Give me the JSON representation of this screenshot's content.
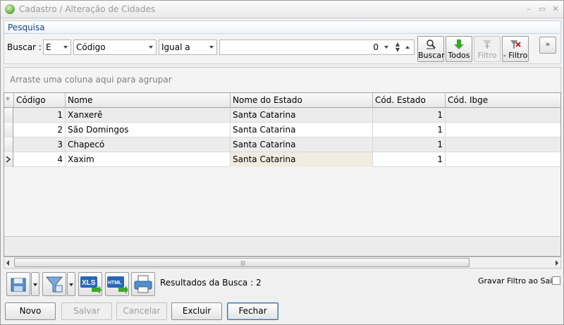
{
  "window": {
    "title": "Cadastro / Alteração de Cidades",
    "controls": [
      "–",
      "▭",
      "✕"
    ]
  },
  "search_panel": {
    "header": "Pesquisa",
    "search_label": "Buscar :",
    "logic_value": "E",
    "field_value": "Código",
    "operator_value": "Igual a",
    "number_value": "0"
  },
  "toolbar": {
    "buscar": "Buscar",
    "todos": "Todos",
    "add_filter": "+ Filtro",
    "remove_filter": "- Filtro",
    "collapse": "»"
  },
  "grid": {
    "group_hint": "Arraste uma coluna aqui para agrupar",
    "corner": "*",
    "columns": [
      "Código",
      "Nome",
      "Nome do Estado",
      "Cód. Estado",
      "Cód. Ibge"
    ],
    "rows": [
      {
        "codigo": "1",
        "nome": "Xanxerê",
        "estado": "Santa Catarina",
        "cod_estado": "1",
        "ibge": ""
      },
      {
        "codigo": "2",
        "nome": "São Domingos",
        "estado": "Santa Catarina",
        "cod_estado": "1",
        "ibge": ""
      },
      {
        "codigo": "3",
        "nome": "Chapecó",
        "estado": "Santa Catarina",
        "cod_estado": "1",
        "ibge": ""
      },
      {
        "codigo": "4",
        "nome": "Xaxim",
        "estado": "Santa Catarina",
        "cod_estado": "1",
        "ibge": ""
      }
    ],
    "scroll_grip": "|||"
  },
  "bottom": {
    "xls_label": "XLS",
    "html_label": "HTML",
    "results_text": "Resultados da Busca : 2",
    "save_filter_label": "Gravar Filtro ao Sair"
  },
  "actions": {
    "novo": "Novo",
    "salvar": "Salvar",
    "cancelar": "Cancelar",
    "excluir": "Excluir",
    "fechar": "Fechar"
  },
  "colors": {
    "accent": "#15428b",
    "focus_cell": "#f0ecdf",
    "filter_green": "#3fa52c"
  }
}
